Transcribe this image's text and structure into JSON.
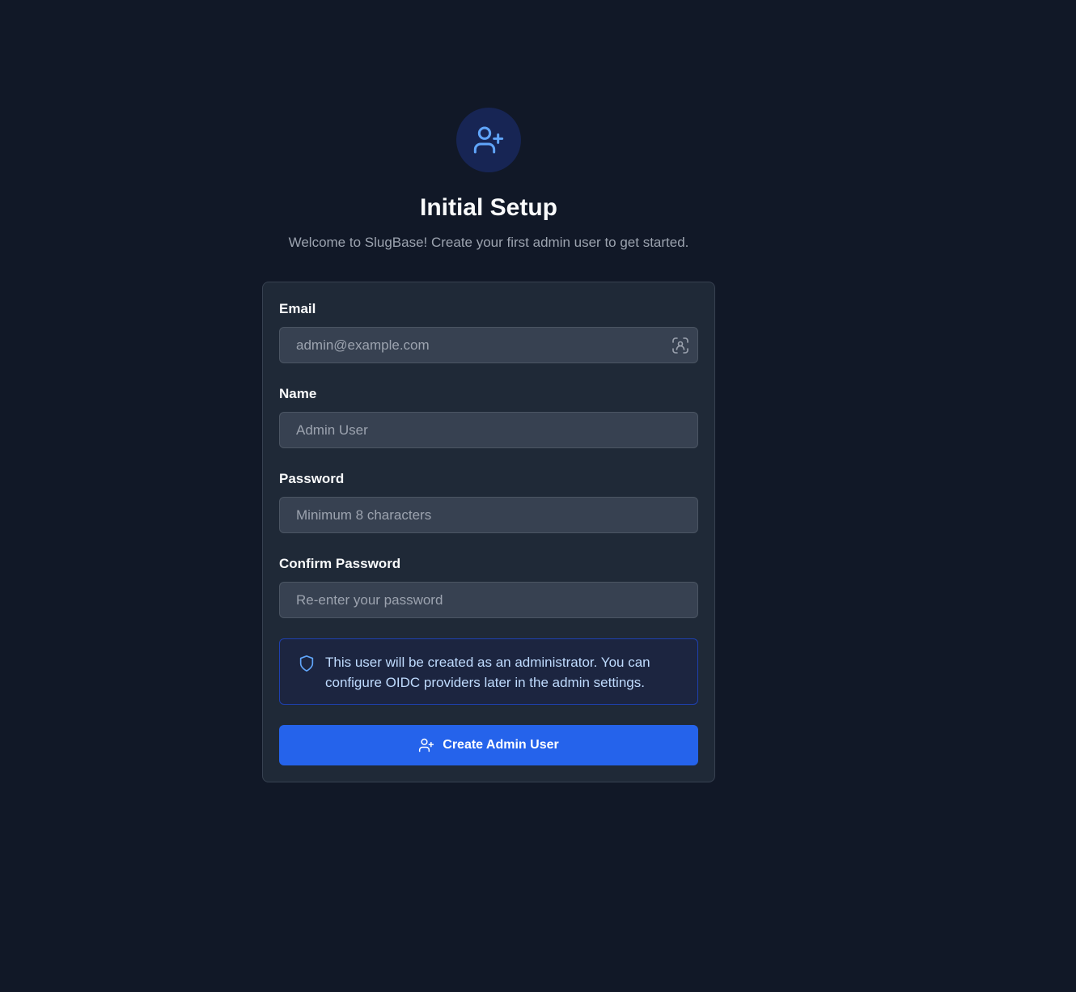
{
  "header": {
    "title": "Initial Setup",
    "subtitle": "Welcome to SlugBase! Create your first admin user to get started.",
    "icon": "user-plus-icon"
  },
  "form": {
    "email": {
      "label": "Email",
      "placeholder": "admin@example.com",
      "value": "",
      "icon": "autofill-contact-icon"
    },
    "name": {
      "label": "Name",
      "placeholder": "Admin User",
      "value": ""
    },
    "password": {
      "label": "Password",
      "placeholder": "Minimum 8 characters",
      "value": ""
    },
    "confirm_password": {
      "label": "Confirm Password",
      "placeholder": "Re-enter your password",
      "value": ""
    },
    "info": {
      "icon": "shield-icon",
      "text": "This user will be created as an administrator. You can configure OIDC providers later in the admin settings."
    },
    "submit": {
      "label": "Create Admin User",
      "icon": "user-plus-icon"
    }
  },
  "colors": {
    "background": "#111827",
    "card": "#1f2937",
    "input": "#374151",
    "accent": "#2563eb",
    "icon_accent": "#60a5fa",
    "info_border": "#1e40af"
  }
}
